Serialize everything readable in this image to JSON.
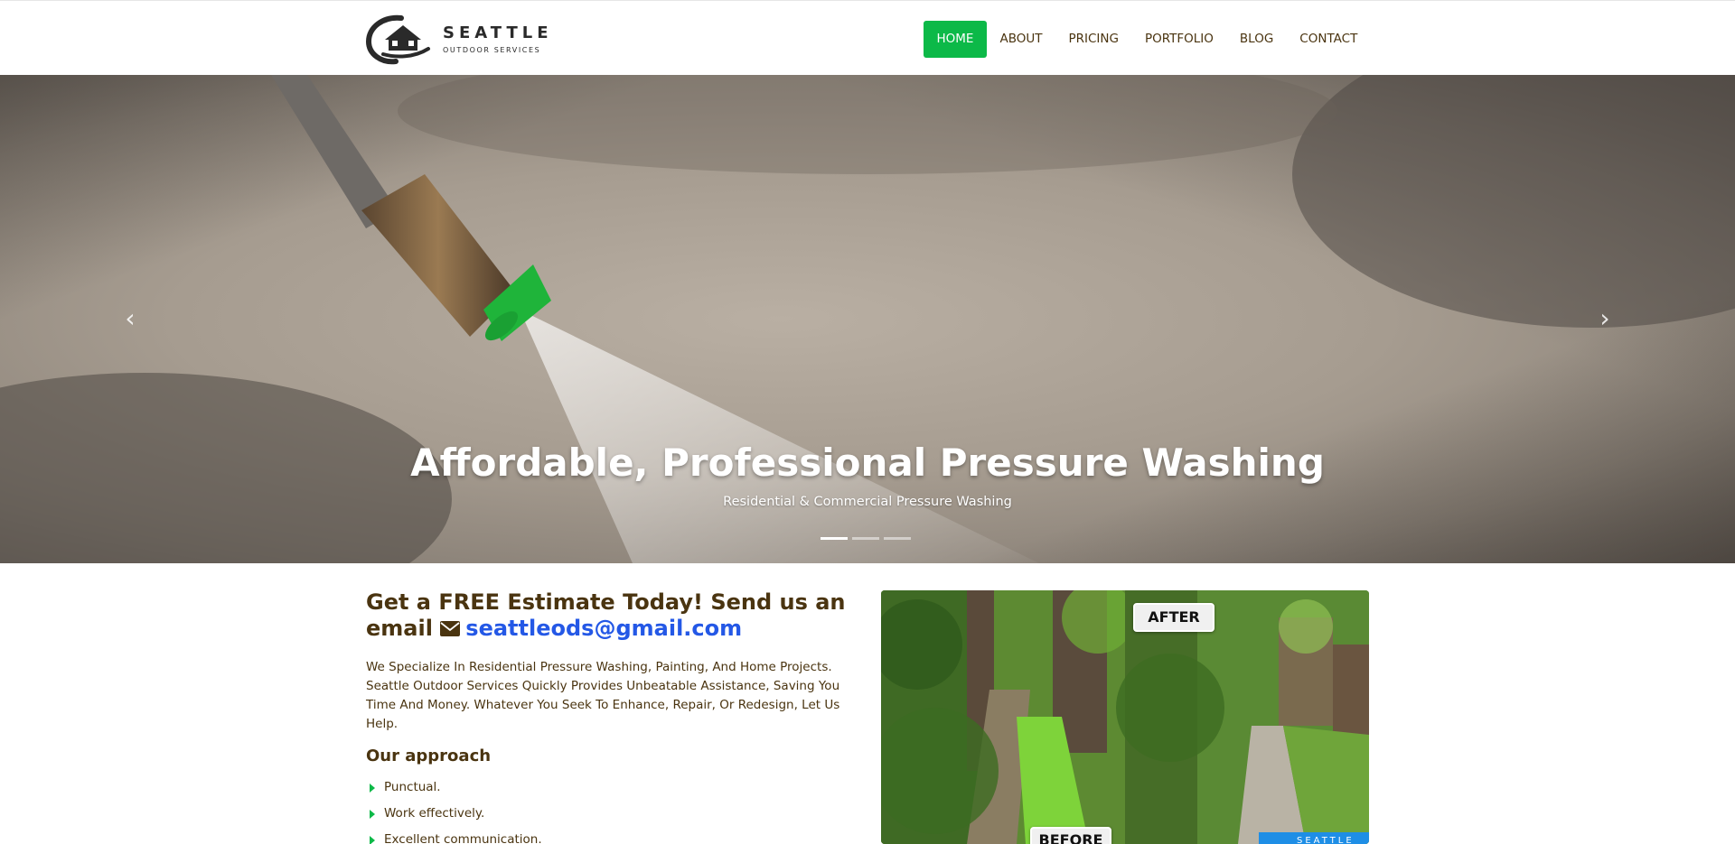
{
  "brand": {
    "title": "SEATTLE",
    "subtitle": "OUTDOOR SERVICES"
  },
  "nav": {
    "items": [
      {
        "label": "HOME",
        "active": true
      },
      {
        "label": "ABOUT",
        "active": false
      },
      {
        "label": "PRICING",
        "active": false
      },
      {
        "label": "PORTFOLIO",
        "active": false
      },
      {
        "label": "BLOG",
        "active": false
      },
      {
        "label": "CONTACT",
        "active": false
      }
    ]
  },
  "hero": {
    "title": "Affordable, Professional Pressure Washing",
    "subtitle": "Residential & Commercial Pressure Washing",
    "slides_count": 3,
    "active_slide": 1,
    "prev_icon": "chevron-left-icon",
    "next_icon": "chevron-right-icon"
  },
  "estimate": {
    "heading": "Get a FREE Estimate Today! Send us an email",
    "icon": "envelope-icon",
    "email": "seattleods@gmail.com"
  },
  "about": {
    "text": "We Specialize In Residential Pressure Washing, Painting, And Home Projects. Seattle Outdoor Services Quickly Provides Unbeatable Assistance, Saving You Time And Money. Whatever You Seek To Enhance, Repair, Or Redesign, Let Us Help."
  },
  "approach": {
    "title": "Our approach",
    "items": [
      "Punctual.",
      "Work effectively.",
      "Excellent communication."
    ]
  },
  "before_after": {
    "after_label": "AFTER",
    "before_label": "BEFORE",
    "watermark": "SEATTLE"
  },
  "colors": {
    "accent": "#0cb948",
    "text": "#4a3410",
    "link": "#2458e6"
  }
}
